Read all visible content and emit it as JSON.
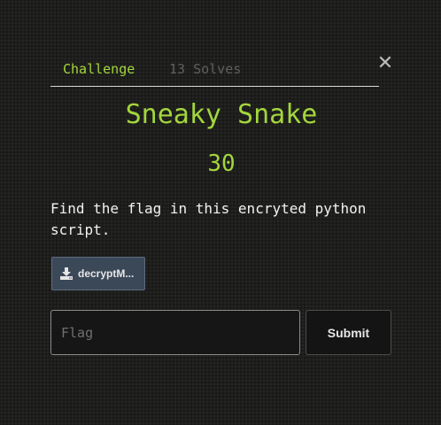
{
  "modal": {
    "tabs": [
      {
        "label": "Challenge",
        "active": true
      },
      {
        "label": "13 Solves",
        "active": false
      }
    ],
    "close_symbol": "✕",
    "challenge": {
      "name": "Sneaky Snake",
      "points": "30",
      "description": "Find the flag in this encryted python script.",
      "file_label": "decryptM...",
      "file_icon": "download-icon"
    },
    "flag": {
      "placeholder": "Flag",
      "value": ""
    },
    "submit_label": "Submit"
  },
  "colors": {
    "accent": "#a3d63d",
    "background": "#1e1f1c",
    "muted_tab": "#5f5f5f",
    "file_button": "#3b4858"
  }
}
